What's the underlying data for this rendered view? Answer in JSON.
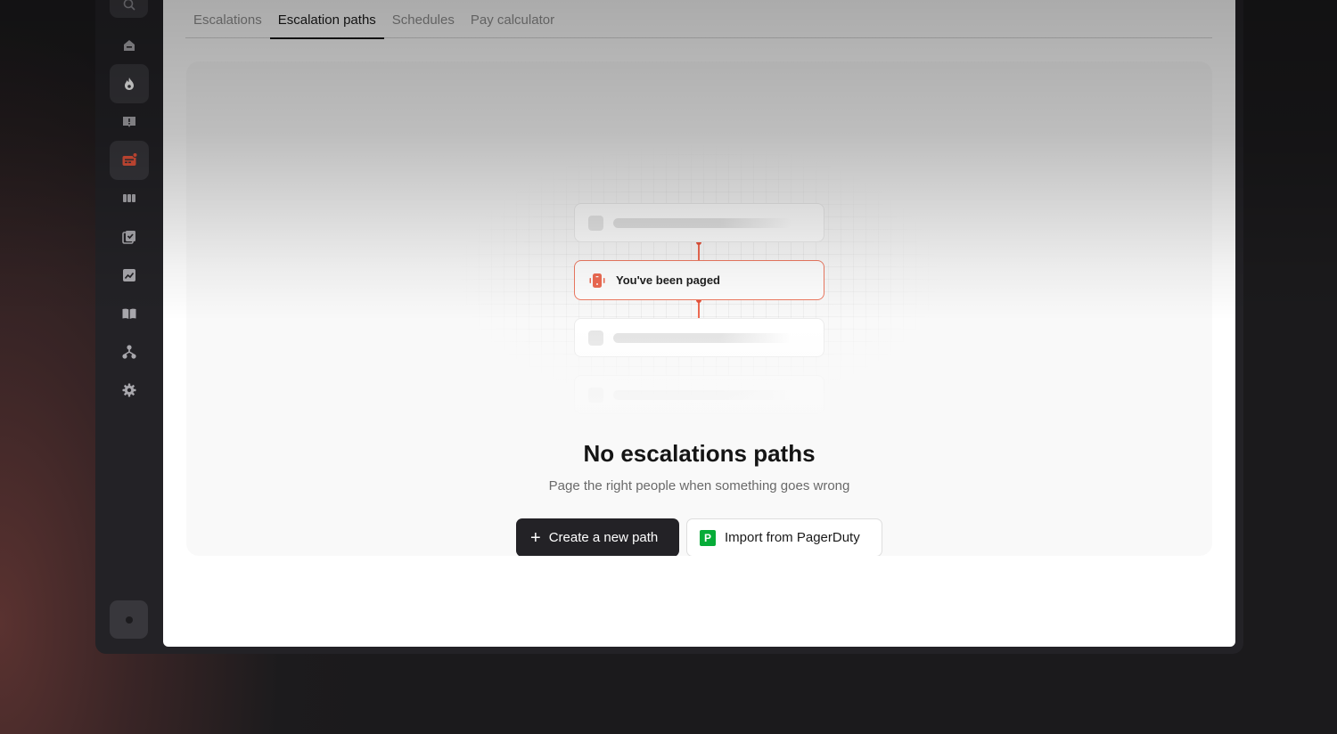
{
  "tabs": [
    {
      "label": "Escalations",
      "active": false
    },
    {
      "label": "Escalation paths",
      "active": true
    },
    {
      "label": "Schedules",
      "active": false
    },
    {
      "label": "Pay calculator",
      "active": false
    }
  ],
  "sidebar": {
    "items": [
      {
        "icon": "home-icon",
        "active": false
      },
      {
        "icon": "flame-icon",
        "active": true
      },
      {
        "icon": "alert-message-icon",
        "active": false
      },
      {
        "icon": "pager-icon",
        "active": true,
        "accent": "#e5533b"
      },
      {
        "icon": "columns-icon",
        "active": false
      },
      {
        "icon": "checklist-icon",
        "active": false
      },
      {
        "icon": "chart-icon",
        "active": false
      },
      {
        "icon": "book-icon",
        "active": false
      },
      {
        "icon": "org-chart-icon",
        "active": false
      },
      {
        "icon": "gear-icon",
        "active": false
      }
    ]
  },
  "illustration": {
    "paged_label": "You've been paged"
  },
  "empty_state": {
    "title": "No escalations paths",
    "subtitle": "Page the right people when something goes wrong",
    "primary_button": "Create a new path",
    "secondary_button": "Import from PagerDuty",
    "pagerduty_logo_letter": "P"
  },
  "colors": {
    "accent": "#e5533b",
    "pagerduty_green": "#06ac38",
    "primary_button_bg": "#232226"
  }
}
